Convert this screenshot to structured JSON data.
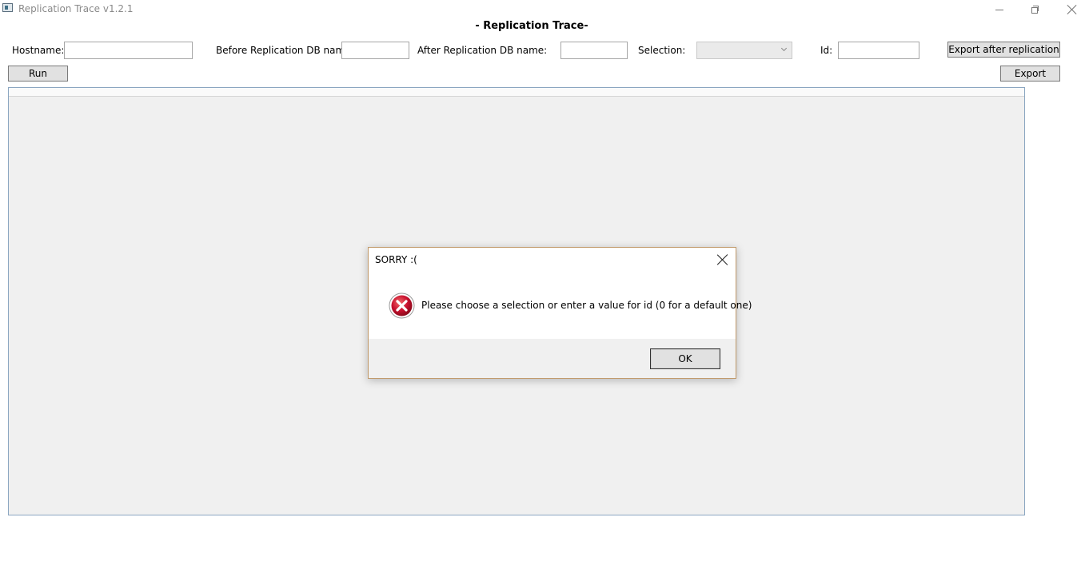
{
  "window": {
    "title": "Replication Trace v1.2.1"
  },
  "header": {
    "title": "- Replication Trace-"
  },
  "form": {
    "hostname_label": "Hostname:",
    "hostname_value": "",
    "before_db_label": "Before Replication DB name:",
    "before_db_value": "",
    "after_db_label": "After Replication DB name:",
    "after_db_value": "",
    "selection_label": "Selection:",
    "selection_value": "",
    "id_label": "Id:",
    "id_value": "",
    "export_after_label": "Export after replication",
    "run_label": "Run",
    "export_label": "Export"
  },
  "dialog": {
    "title": "SORRY :(",
    "message": "Please choose a selection or enter a value for id (0 for a default one)",
    "ok_label": "OK",
    "icon": "error-icon"
  },
  "colors": {
    "error_red": "#c8102e",
    "grid_border": "#8ba6c1",
    "dialog_border": "#c19a6b"
  }
}
